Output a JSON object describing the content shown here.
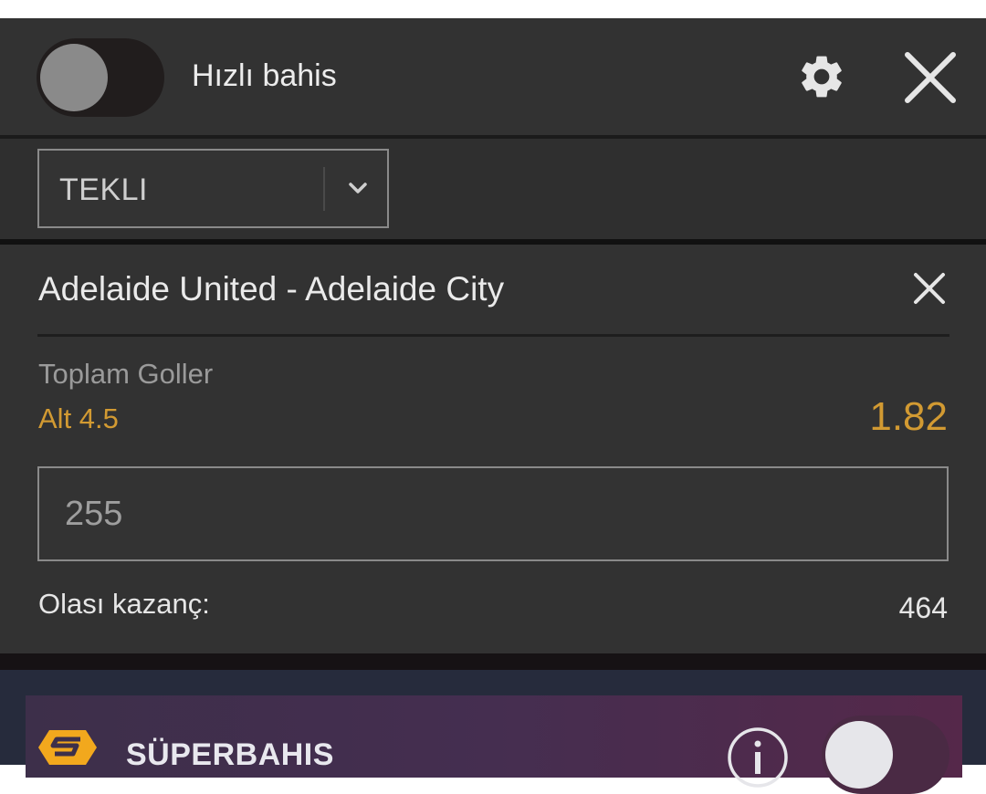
{
  "header": {
    "quick_bet_label": "Hızlı bahis",
    "quick_bet_enabled": false,
    "settings_icon": "gear-icon",
    "close_icon": "close-icon"
  },
  "bet_type": {
    "selected": "TEKLI",
    "chevron_icon": "chevron-down-icon"
  },
  "bet": {
    "match": "Adelaide United - Adelaide City",
    "market": "Toplam Goller",
    "selection": "Alt 4.5",
    "odds": "1.82",
    "stake_placeholder": "255",
    "winnings_label": "Olası kazanç:",
    "winnings_value": "464"
  },
  "super_bet": {
    "title": "SÜPERBAHIS",
    "info_icon": "info-icon",
    "enabled": false
  },
  "colors": {
    "accent": "#d29a32",
    "panel": "#323232",
    "super_panel": "#452e50"
  }
}
